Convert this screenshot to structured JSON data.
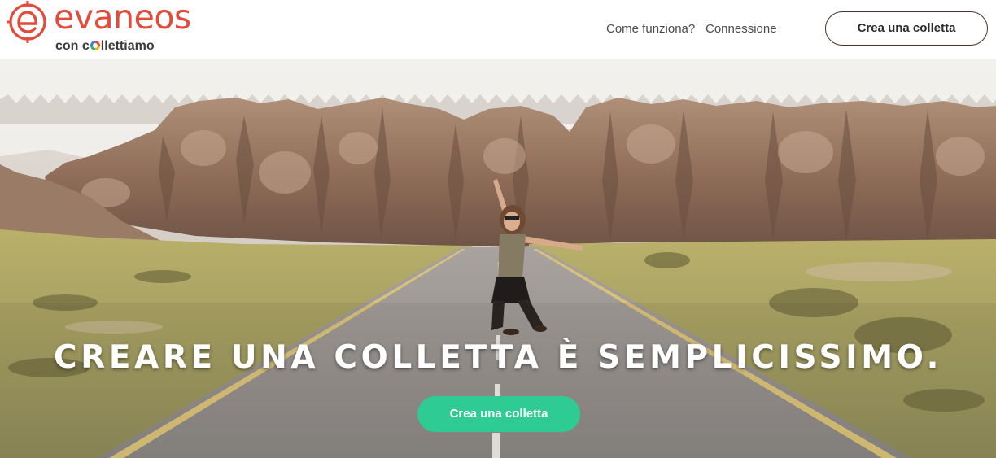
{
  "header": {
    "logo": {
      "wordmark": "evaneos",
      "subtitle_prefix": "con c",
      "subtitle_suffix": "llettiamo",
      "brand_color": "#e24c3c"
    },
    "nav": {
      "how_it_works": "Come funziona?",
      "login": "Connessione"
    },
    "cta_label": "Crea una colletta"
  },
  "hero": {
    "title": "CREARE UNA COLLETTA È SEMPLICISSIMO.",
    "cta_label": "Crea una colletta",
    "cta_color": "#2ecc94"
  }
}
